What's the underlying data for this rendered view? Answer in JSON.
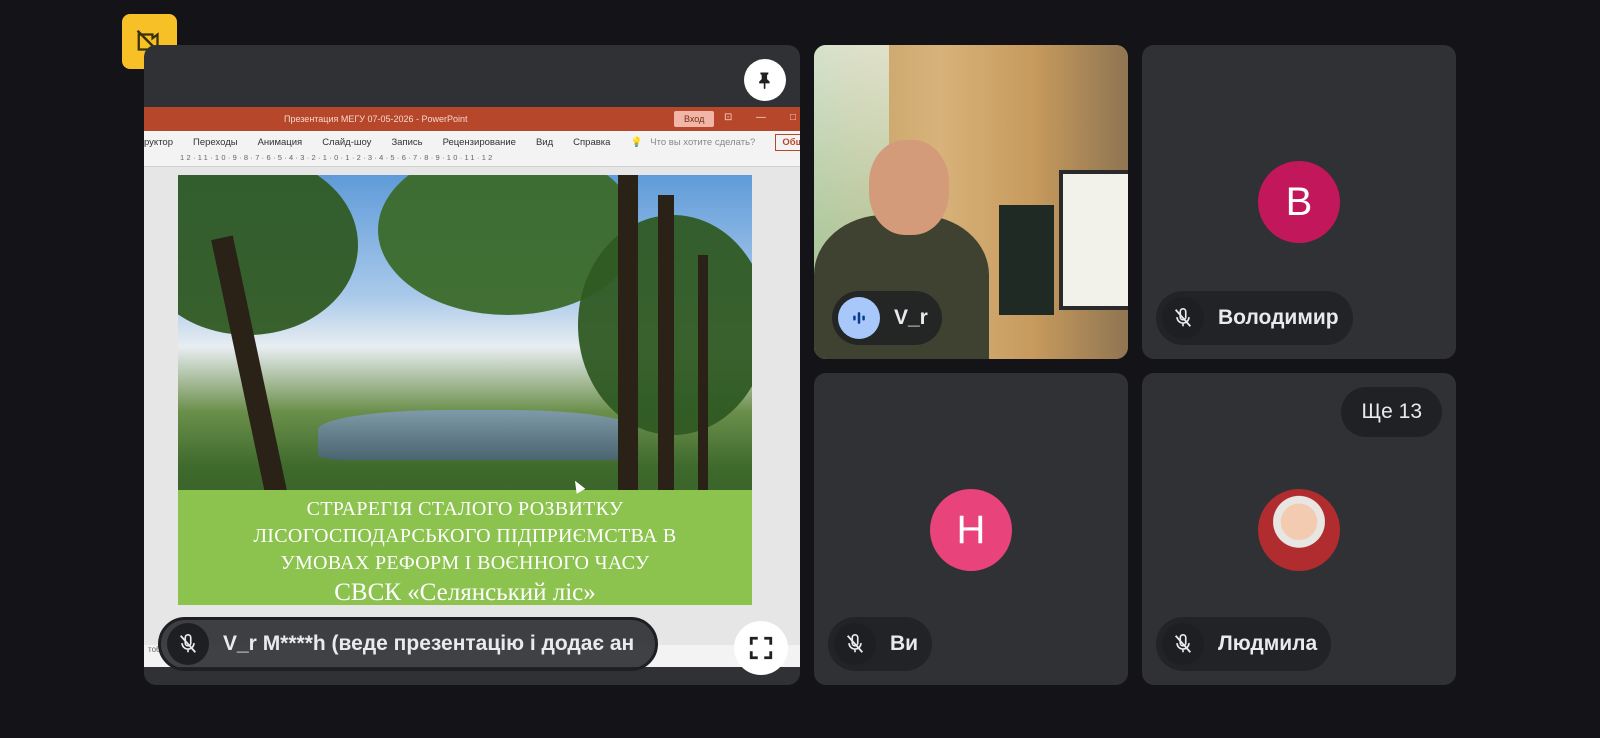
{
  "presentation": {
    "presenter_name": "V_r M****h (веде презентацію і додає ан",
    "powerpoint": {
      "window_title": "Презентация МЕГУ 07-05-2026  -  PowerPoint",
      "login_label": "Вход",
      "ribbon_tabs": [
        "руктор",
        "Переходы",
        "Анимация",
        "Слайд-шоу",
        "Запись",
        "Рецензирование",
        "Вид",
        "Справка"
      ],
      "tell_me_placeholder": "Что вы хотите сделать?",
      "share_label": "Общий д",
      "ruler": "12·11·10·9·8·7·6·5·4·3·2·1·0·1·2·3·4·5·6·7·8·9·10·11·12",
      "status_left": "тоб"
    },
    "slide": {
      "caption_lines": [
        "СТРАРЕГІЯ СТАЛОГО РОЗВИТКУ",
        "ЛІСОГОСПОДАРСЬКОГО ПІДПРИЄМСТВА В",
        "УМОВАХ РЕФОРМ І ВОЄННОГО ЧАСУ"
      ],
      "caption_org": "СВСК «Селянський ліс»"
    }
  },
  "participants": {
    "video": {
      "name": "V_r"
    },
    "volodymyr": {
      "initial": "В",
      "name": "Володимир",
      "color": "#c2185b"
    },
    "you": {
      "initial": "Н",
      "name": "Ви",
      "color": "#e8437a"
    },
    "liudmyla": {
      "name": "Людмила"
    },
    "more_count": "Ще 13"
  },
  "colors": {
    "background": "#131318",
    "tile": "#303134",
    "warning_badge": "#f6c026",
    "slide_caption": "#8cc34f",
    "speaking": "#a8c7fa"
  }
}
